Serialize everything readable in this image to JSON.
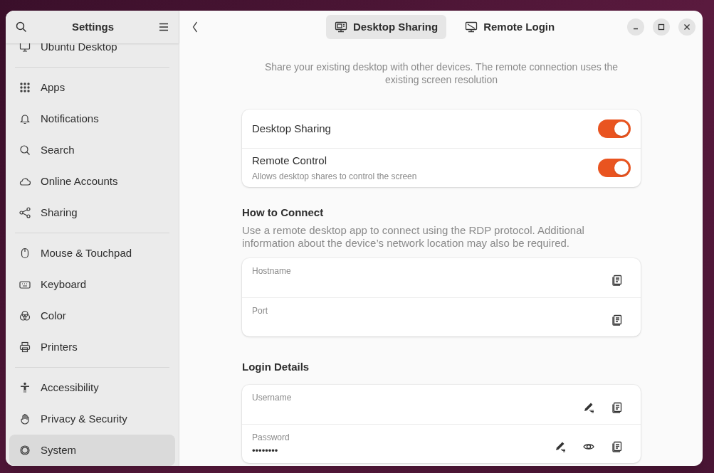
{
  "sidebar": {
    "title": "Settings",
    "sections": [
      {
        "items": [
          {
            "label": "Ubuntu Desktop",
            "selected": false
          }
        ]
      },
      {
        "items": [
          {
            "label": "Apps",
            "selected": false
          },
          {
            "label": "Notifications",
            "selected": false
          },
          {
            "label": "Search",
            "selected": false
          },
          {
            "label": "Online Accounts",
            "selected": false
          },
          {
            "label": "Sharing",
            "selected": false
          }
        ]
      },
      {
        "items": [
          {
            "label": "Mouse & Touchpad",
            "selected": false
          },
          {
            "label": "Keyboard",
            "selected": false
          },
          {
            "label": "Color",
            "selected": false
          },
          {
            "label": "Printers",
            "selected": false
          }
        ]
      },
      {
        "items": [
          {
            "label": "Accessibility",
            "selected": false
          },
          {
            "label": "Privacy & Security",
            "selected": false
          },
          {
            "label": "System",
            "selected": true
          }
        ]
      }
    ]
  },
  "tabs": [
    {
      "label": "Desktop Sharing",
      "selected": true
    },
    {
      "label": "Remote Login",
      "selected": false
    }
  ],
  "intro": "Share your existing desktop with other devices. The remote connection uses the existing screen resolution",
  "toggles": [
    {
      "label": "Desktop Sharing",
      "on": true
    },
    {
      "label": "Remote Control",
      "subtitle": "Allows desktop shares to control the screen",
      "on": true
    }
  ],
  "sections": [
    {
      "title": "How to Connect",
      "description": "Use a remote desktop app to connect using the RDP protocol. Additional information about the device’s network location may also be required.",
      "fields": [
        {
          "label": "Hostname",
          "kind": "readonly"
        },
        {
          "label": "Port",
          "kind": "readonly"
        }
      ]
    },
    {
      "title": "Login Details",
      "fields": [
        {
          "label": "Username",
          "kind": "editable"
        },
        {
          "label": "Password",
          "kind": "secret",
          "value": "••••••••"
        }
      ]
    }
  ]
}
